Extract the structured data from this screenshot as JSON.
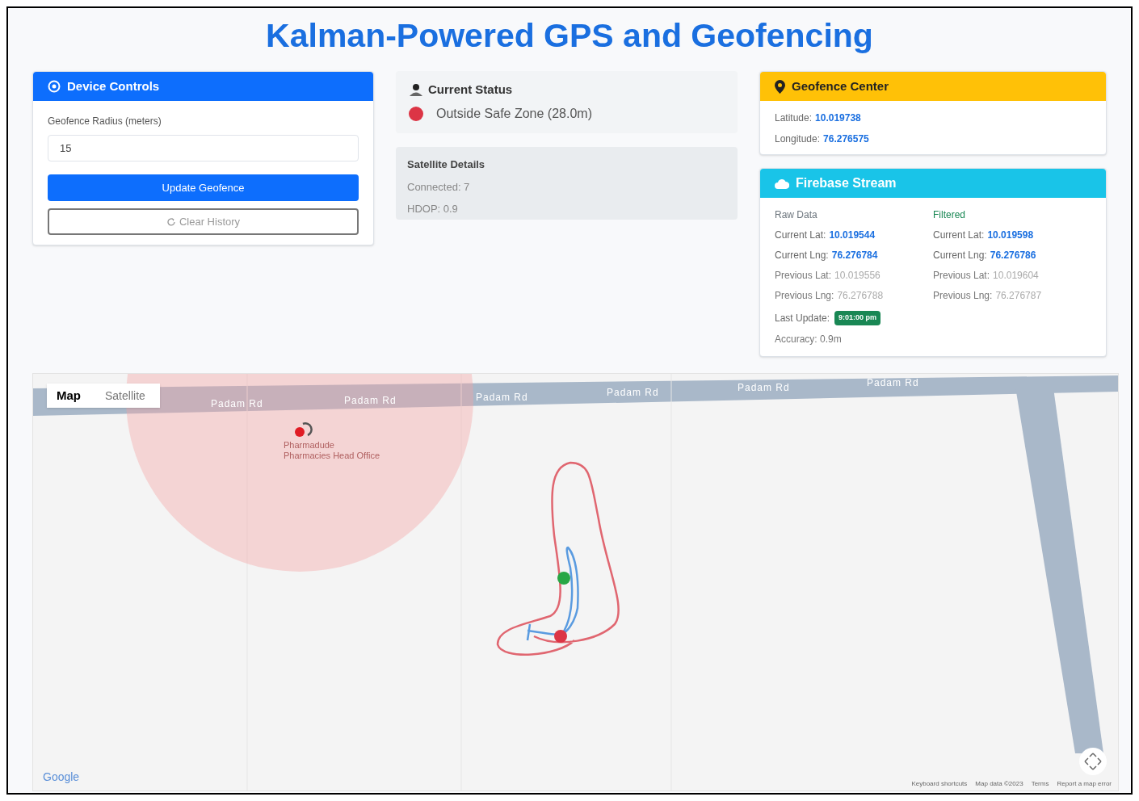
{
  "title": "Kalman-Powered GPS and Geofencing",
  "device_controls": {
    "title": "Device Controls",
    "radius_label": "Geofence Radius (meters)",
    "radius_value": "15",
    "update_button": "Update Geofence",
    "clear_button": "Clear History"
  },
  "status": {
    "title": "Current Status",
    "text": "Outside Safe Zone (28.0m)"
  },
  "satellite": {
    "title": "Satellite Details",
    "lines": [
      "Connected: 7",
      "HDOP: 0.9"
    ]
  },
  "geofence_center": {
    "title": "Geofence Center",
    "rows": [
      {
        "label": "Latitude:",
        "value": "10.019738"
      },
      {
        "label": "Longitude:",
        "value": "76.276575"
      }
    ]
  },
  "firebase": {
    "title": "Firebase Stream",
    "columns": [
      {
        "heading": "Raw Data",
        "color": "#6c757d",
        "rows": [
          {
            "label": "Current Lat:",
            "value": "10.019544",
            "kind": "current"
          },
          {
            "label": "Current Lng:",
            "value": "76.276784",
            "kind": "current"
          },
          {
            "label": "Previous Lat:",
            "value": "10.019556",
            "kind": "previous"
          },
          {
            "label": "Previous Lng:",
            "value": "76.276788",
            "kind": "previous"
          }
        ]
      },
      {
        "heading": "Filtered",
        "color": "#198754",
        "rows": [
          {
            "label": "Current Lat:",
            "value": "10.019598",
            "kind": "current"
          },
          {
            "label": "Current Lng:",
            "value": "76.276786",
            "kind": "current"
          },
          {
            "label": "Previous Lat:",
            "value": "10.019604",
            "kind": "previous"
          },
          {
            "label": "Previous Lng:",
            "value": "76.276787",
            "kind": "previous"
          }
        ]
      }
    ],
    "last_update_label": "Last Update:",
    "last_update_value": "9:01:00 pm",
    "accuracy": "Accuracy: 0.9m"
  },
  "map": {
    "tabs": [
      {
        "label": "Map",
        "selected": true
      },
      {
        "label": "Satellite",
        "selected": false
      }
    ],
    "road_labels": [
      "Padam Rd",
      "Padam Rd",
      "Padam Rd",
      "Padam Rd",
      "Padam Rd",
      "Padam Rd"
    ],
    "poi_lines": [
      "Pharmadude",
      "Pharmacies Head Office"
    ],
    "logo": "Google",
    "footer": [
      "Keyboard shortcuts",
      "Map data ©2023",
      "Terms",
      "Report a map error"
    ]
  }
}
